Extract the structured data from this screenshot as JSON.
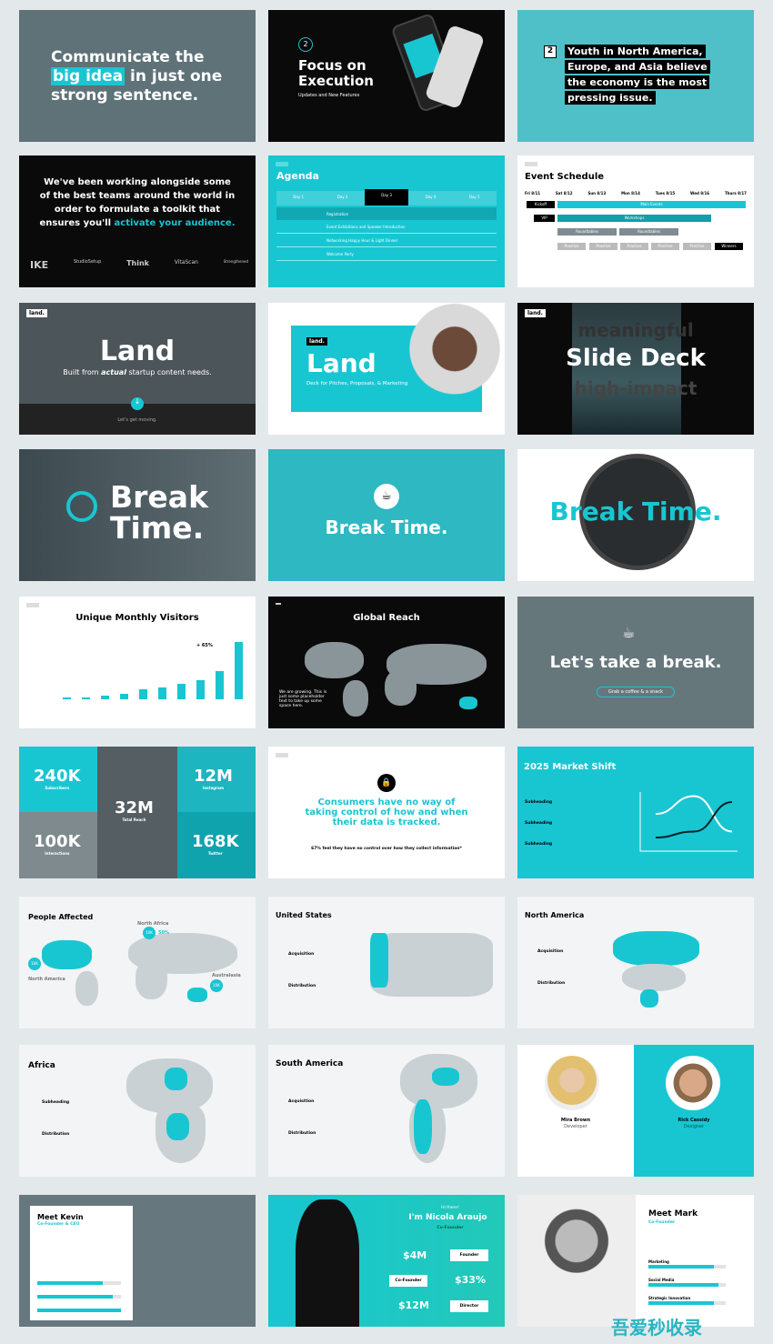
{
  "slides": {
    "s1": {
      "line1": "Communicate the",
      "highlight": "big idea",
      "line2": " in just one",
      "line3": "strong sentence."
    },
    "s2": {
      "number": "2",
      "title": "Focus on Execution",
      "subtitle": "Updates and New Features"
    },
    "s3": {
      "number": "2",
      "text": "Youth in North America, Europe, and Asia believe the economy is the most pressing issue."
    },
    "s4": {
      "text": "We've been working alongside some of the best teams around the world in order to formulate a toolkit that ensures you'll",
      "accent": "activate your audience.",
      "logos": [
        "IKE",
        "StudioSetup",
        "Think",
        "VitaScan",
        "Strengthened"
      ]
    },
    "s5": {
      "title": "Agenda",
      "days": [
        "Day 1",
        "Day 2",
        "Day 3",
        "Day 4",
        "Day 5"
      ],
      "rows": [
        "Registration",
        "Event Exhibitions and Speaker Introduction",
        "Networking Happy Hour & Light Dinner",
        "Welcome Party"
      ]
    },
    "s6": {
      "title": "Event Schedule",
      "days": [
        "Fri 8/11",
        "Sat 8/12",
        "Sun 8/13",
        "Mon 8/14",
        "Tues 8/15",
        "Wed 8/16",
        "Thurs 8/17"
      ],
      "kickoff": "Kickoff",
      "vip": "VIP",
      "main": "Main Events",
      "workshops": "Workshops",
      "round": "Roundtables",
      "practice": "Practice",
      "winners": "Winners"
    },
    "s7": {
      "tag": "land.",
      "title": "Land",
      "subtitle_pre": "Built from ",
      "subtitle_em": "actual",
      "subtitle_post": " startup content needs.",
      "cta": "Let's get moving."
    },
    "s8": {
      "tag": "land.",
      "title": "Land",
      "subtitle": "Deck for Pitches, Proposals, & Marketing"
    },
    "s9": {
      "tag": "land.",
      "top": "meaningful",
      "title": "Slide Deck",
      "bottom": "high-impact"
    },
    "s10": {
      "title1": "Break",
      "title2": "Time."
    },
    "s11": {
      "title": "Break Time."
    },
    "s12": {
      "title": "Break Time."
    },
    "s13": {
      "title": "Unique Monthly Visitors",
      "growth": "+ 65%"
    },
    "s14": {
      "title": "Global Reach",
      "text": "We are growing. This is just some placeholder text to take up some space here."
    },
    "s15": {
      "title": "Let's take a break.",
      "button": "Grab a coffee & a snack"
    },
    "s16": {
      "stats": [
        {
          "value": "240K",
          "label": "Subscribers"
        },
        {
          "value": "12M",
          "label": "Instagram"
        },
        {
          "value": "32M",
          "label": "Total Reach"
        },
        {
          "value": "100K",
          "label": "Interactions"
        },
        {
          "value": "168K",
          "label": "Twitter"
        }
      ]
    },
    "s17": {
      "quote": "Consumers have no way of taking control of how and when their data is tracked.",
      "note": "67% feel they have no control over how they collect information*"
    },
    "s18": {
      "title": "2025 Market Shift",
      "items": [
        "Subheading",
        "Subheading",
        "Subheading"
      ]
    },
    "s19": {
      "title": "People Affected",
      "regions": [
        "North Africa",
        "North America",
        "Australasia"
      ],
      "bubble": "10K",
      "pct": "50%"
    },
    "s20": {
      "title": "United States",
      "items": [
        "Acquisition",
        "Distribution"
      ]
    },
    "s21": {
      "title": "North America",
      "items": [
        "Acquisition",
        "Distribution"
      ]
    },
    "s22": {
      "title": "Africa",
      "items": [
        "Subheading",
        "Distribution"
      ]
    },
    "s23": {
      "title": "South America",
      "items": [
        "Acquisition",
        "Distribution"
      ]
    },
    "s24": {
      "p1": {
        "name": "Mira Brown",
        "role": "Developer"
      },
      "p2": {
        "name": "Rick Cassidy",
        "role": "Designer"
      }
    },
    "s25": {
      "title": "Meet Kevin",
      "role": "Co-Founder & CEO",
      "bars": [
        0.78,
        0.9,
        1.0
      ]
    },
    "s26": {
      "hi": "Hi there!",
      "title": "I'm Nicola Araujo",
      "role": "Co-Founder",
      "stats": [
        "$4M",
        "$33%",
        "$12M"
      ],
      "roles": [
        "Founder",
        "Co-Founder",
        "Director"
      ]
    },
    "s27": {
      "title": "Meet Mark",
      "role": "Co-Founder",
      "skills": [
        "Marketing",
        "Social Media",
        "Strategic Innovation"
      ],
      "levels": [
        0.85,
        0.9,
        0.85
      ]
    }
  },
  "watermark": "吾爱秒收录",
  "colors": {
    "accent": "#18c6d2",
    "dark": "#0a0a0a",
    "grey": "#5e7278"
  },
  "chart_data": [
    {
      "type": "bar",
      "title": "Unique Monthly Visitors",
      "values": [
        2,
        2,
        4,
        7,
        12,
        15,
        19,
        23,
        35,
        70
      ],
      "annotations": [
        "+ 65%"
      ]
    },
    {
      "type": "line",
      "title": "2025 Market Shift",
      "series": [
        {
          "values": [
            3,
            4.5,
            1.5
          ]
        },
        {
          "values": [
            1,
            1.5,
            4
          ]
        }
      ]
    }
  ]
}
